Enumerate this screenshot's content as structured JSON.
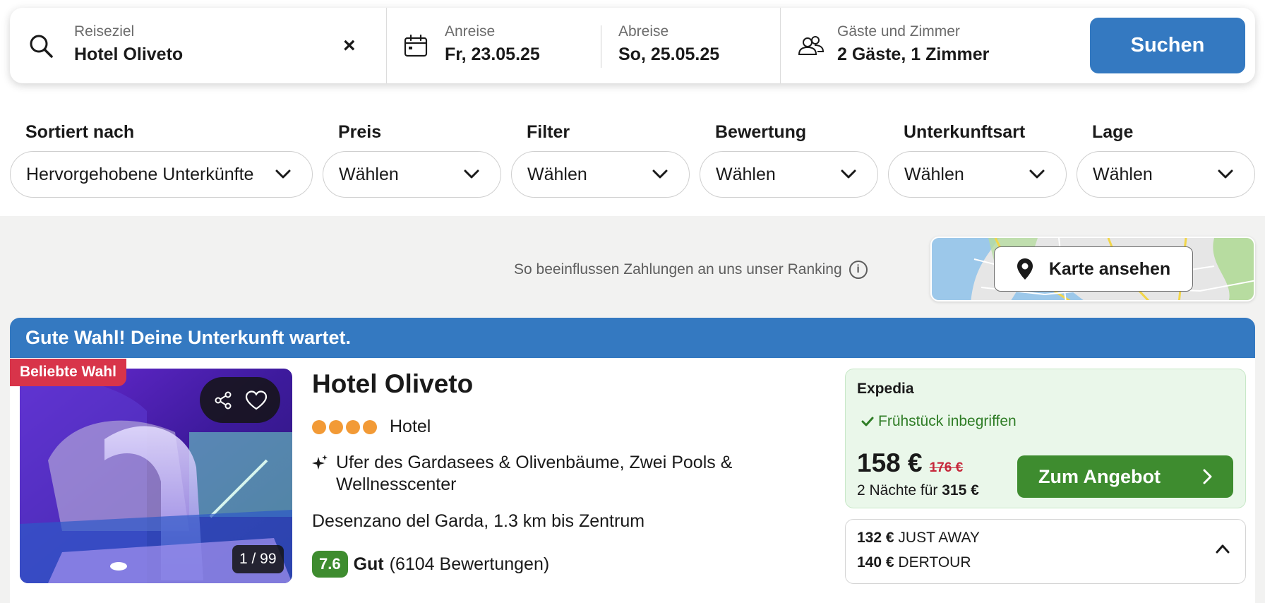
{
  "search": {
    "destination_label": "Reiseziel",
    "destination_value": "Hotel Oliveto",
    "clear_symbol": "×",
    "checkin_label": "Anreise",
    "checkin_value": "Fr, 23.05.25",
    "checkout_label": "Abreise",
    "checkout_value": "So, 25.05.25",
    "guests_label": "Gäste und Zimmer",
    "guests_value": "2 Gäste, 1 Zimmer",
    "search_button": "Suchen"
  },
  "filters": [
    {
      "label": "Sortiert nach",
      "value": "Hervorgehobene Unterkünfte"
    },
    {
      "label": "Preis",
      "value": "Wählen"
    },
    {
      "label": "Filter",
      "value": "Wählen"
    },
    {
      "label": "Bewertung",
      "value": "Wählen"
    },
    {
      "label": "Unterkunftsart",
      "value": "Wählen"
    },
    {
      "label": "Lage",
      "value": "Wählen"
    }
  ],
  "ranking_info": "So beeinflussen Zahlungen an uns unser Ranking",
  "info_symbol": "i",
  "map_button": "Karte ansehen",
  "result": {
    "banner": "Gute Wahl! Deine Unterkunft wartet.",
    "badge": "Beliebte Wahl",
    "photo_counter": "1 / 99",
    "name": "Hotel Oliveto",
    "stars": 4,
    "type": "Hotel",
    "highlight": "Ufer des Gardasees & Olivenbäume, Zwei Pools & Wellnesscenter",
    "location": "Desenzano del Garda, 1.3 km bis Zentrum",
    "rating_score": "7.6",
    "rating_word": "Gut",
    "rating_count": "(6104 Bewertungen)",
    "offer": {
      "provider": "Expedia",
      "perk": "Frühstück inbegriffen",
      "price": "158 €",
      "old_price": "176 €",
      "total_prefix": "2 Nächte für",
      "total_value": "315 €",
      "button": "Zum Angebot"
    },
    "alt_offers": [
      {
        "price": "132 €",
        "provider": "JUST AWAY"
      },
      {
        "price": "140 €",
        "provider": "DERTOUR"
      }
    ]
  },
  "colors": {
    "accent_blue": "#3479c1",
    "deal_green": "#3e8c2f",
    "badge_red": "#d8344a",
    "star_orange": "#f29a36"
  }
}
